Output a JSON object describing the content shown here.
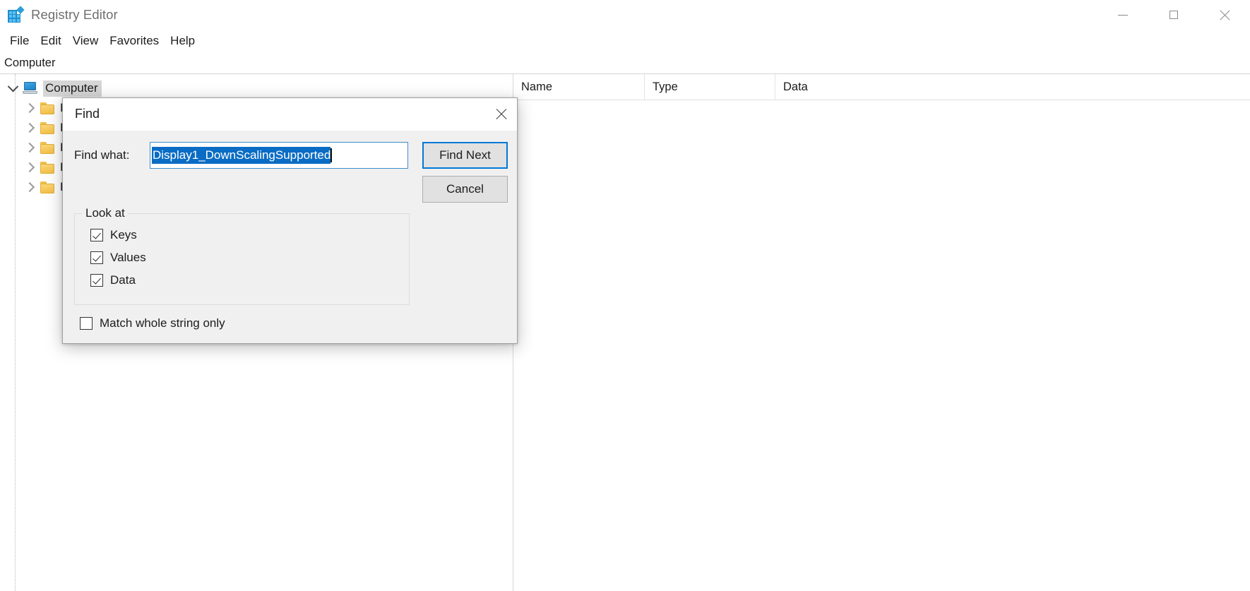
{
  "window": {
    "title": "Registry Editor",
    "icon": "registry-app-icon",
    "controls": {
      "minimize": "minimize-icon",
      "maximize": "maximize-icon",
      "close": "close-icon"
    }
  },
  "menubar": {
    "items": [
      {
        "label": "File"
      },
      {
        "label": "Edit"
      },
      {
        "label": "View"
      },
      {
        "label": "Favorites"
      },
      {
        "label": "Help"
      }
    ]
  },
  "address": {
    "path": "Computer"
  },
  "tree": {
    "root": {
      "label": "Computer",
      "expanded": true,
      "selected": true
    },
    "children": [
      {
        "label": "H",
        "expanded": false
      },
      {
        "label": "H",
        "expanded": false
      },
      {
        "label": "H",
        "expanded": false
      },
      {
        "label": "H",
        "expanded": false
      },
      {
        "label": "H",
        "expanded": false
      }
    ]
  },
  "list": {
    "columns": [
      {
        "label": "Name"
      },
      {
        "label": "Type"
      },
      {
        "label": "Data"
      }
    ],
    "rows": []
  },
  "find_dialog": {
    "title": "Find",
    "close_icon": "close-icon",
    "find_what_label": "Find what:",
    "find_what_value": "Display1_DownScalingSupported",
    "find_what_placeholder": "",
    "find_what_selected": true,
    "buttons": {
      "find_next": "Find Next",
      "cancel": "Cancel"
    },
    "look_at": {
      "legend": "Look at",
      "options": [
        {
          "label": "Keys",
          "checked": true
        },
        {
          "label": "Values",
          "checked": true
        },
        {
          "label": "Data",
          "checked": true
        }
      ]
    },
    "match_whole": {
      "label": "Match whole string only",
      "checked": false
    }
  },
  "colors": {
    "accent": "#0078d7",
    "selection": "#0a6cc4",
    "tree_selection": "#d6d6d6",
    "dialog_bg": "#f0f0f0",
    "folder": "#f3bf45"
  }
}
